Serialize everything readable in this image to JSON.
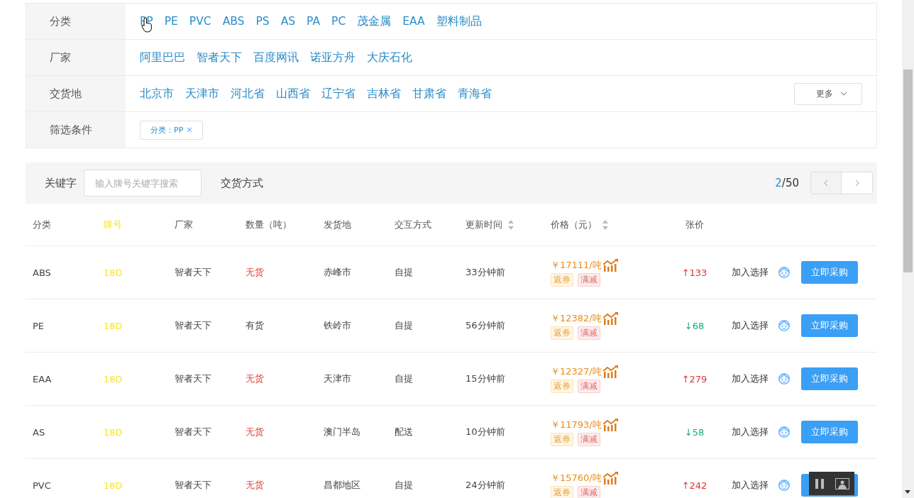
{
  "filters": [
    {
      "label": "分类",
      "options": [
        "PP",
        "PE",
        "PVC",
        "ABS",
        "PS",
        "AS",
        "PA",
        "PC",
        "茂金属",
        "EAA",
        "塑料制品"
      ]
    },
    {
      "label": "厂家",
      "options": [
        "阿里巴巴",
        "智者天下",
        "百度网讯",
        "诺亚方舟",
        "大庆石化"
      ]
    },
    {
      "label": "交货地",
      "options": [
        "北京市",
        "天津市",
        "河北省",
        "山西省",
        "辽宁省",
        "吉林省",
        "甘肃省",
        "青海省"
      ],
      "more": "更多"
    },
    {
      "label": "筛选条件",
      "chips": [
        "分类：PP"
      ]
    }
  ],
  "toolbar": {
    "keyword_label": "关键字",
    "keyword_placeholder": "输入牌号关键字搜索",
    "delivery_label": "交货方式",
    "page_current": "2",
    "page_total": "/50"
  },
  "columns": [
    {
      "label": "分类",
      "sortable": false,
      "highlight": false
    },
    {
      "label": "牌号",
      "sortable": false,
      "highlight": true
    },
    {
      "label": "厂家",
      "sortable": false,
      "highlight": false
    },
    {
      "label": "数量（吨）",
      "sortable": false,
      "highlight": false
    },
    {
      "label": "发货地",
      "sortable": false,
      "highlight": false
    },
    {
      "label": "交互方式",
      "sortable": false,
      "highlight": false
    },
    {
      "label": "更新时间",
      "sortable": true,
      "highlight": false
    },
    {
      "label": "价格（元）",
      "sortable": true,
      "highlight": false
    },
    {
      "label": "张价",
      "sortable": false,
      "highlight": false
    }
  ],
  "rows": [
    {
      "category": "ABS",
      "grade": "18D",
      "maker": "智者天下",
      "stock": "无货",
      "in_stock": false,
      "origin": "赤峰市",
      "delivery": "自提",
      "updated": "33分钟前",
      "price": "￥17111/吨",
      "tags": [
        "返券",
        "满减"
      ],
      "color": "#dd3333",
      "change": "↑133",
      "add": "加入选择",
      "buy": "立即采购"
    },
    {
      "category": "PE",
      "grade": "18D",
      "maker": "智者天下",
      "stock": "有货",
      "in_stock": true,
      "origin": "铁岭市",
      "delivery": "自提",
      "updated": "56分钟前",
      "price": "￥12382/吨",
      "tags": [
        "返券",
        "满减"
      ],
      "color": "#1fa67a",
      "change": "↓68",
      "add": "加入选择",
      "buy": "立即采购"
    },
    {
      "category": "EAA",
      "grade": "18D",
      "maker": "智者天下",
      "stock": "无货",
      "in_stock": false,
      "origin": "天津市",
      "delivery": "自提",
      "updated": "15分钟前",
      "price": "￥12327/吨",
      "tags": [
        "返券",
        "满减"
      ],
      "color": "#dd3333",
      "change": "↑279",
      "add": "加入选择",
      "buy": "立即采购"
    },
    {
      "category": "AS",
      "grade": "18D",
      "maker": "智者天下",
      "stock": "无货",
      "in_stock": false,
      "origin": "澳门半岛",
      "delivery": "配送",
      "updated": "10分钟前",
      "price": "￥11793/吨",
      "tags": [
        "返券",
        "满减"
      ],
      "color": "#1fa67a",
      "change": "↓58",
      "add": "加入选择",
      "buy": "立即采购"
    },
    {
      "category": "PVC",
      "grade": "18D",
      "maker": "智者天下",
      "stock": "无货",
      "in_stock": false,
      "origin": "昌都地区",
      "delivery": "自提",
      "updated": "24分钟前",
      "price": "￥15760/吨",
      "tags": [
        "返券",
        "满减"
      ],
      "color": "#dd3333",
      "change": "↑242",
      "add": "加入选择"
    }
  ]
}
